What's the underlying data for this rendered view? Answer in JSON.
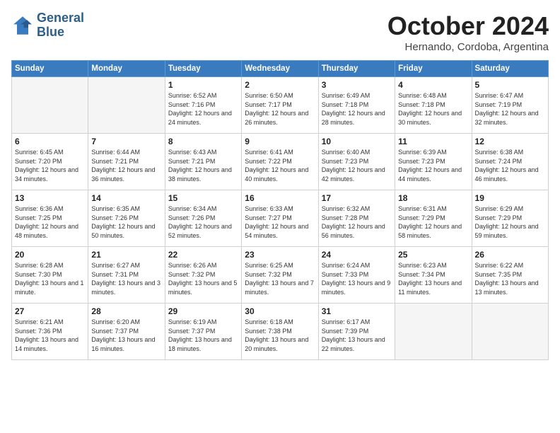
{
  "logo": {
    "line1": "General",
    "line2": "Blue"
  },
  "title": "October 2024",
  "location": "Hernando, Cordoba, Argentina",
  "days_of_week": [
    "Sunday",
    "Monday",
    "Tuesday",
    "Wednesday",
    "Thursday",
    "Friday",
    "Saturday"
  ],
  "weeks": [
    [
      {
        "day": "",
        "empty": true
      },
      {
        "day": "",
        "empty": true
      },
      {
        "day": "1",
        "sunrise": "6:52 AM",
        "sunset": "7:16 PM",
        "daylight": "12 hours and 24 minutes."
      },
      {
        "day": "2",
        "sunrise": "6:50 AM",
        "sunset": "7:17 PM",
        "daylight": "12 hours and 26 minutes."
      },
      {
        "day": "3",
        "sunrise": "6:49 AM",
        "sunset": "7:18 PM",
        "daylight": "12 hours and 28 minutes."
      },
      {
        "day": "4",
        "sunrise": "6:48 AM",
        "sunset": "7:18 PM",
        "daylight": "12 hours and 30 minutes."
      },
      {
        "day": "5",
        "sunrise": "6:47 AM",
        "sunset": "7:19 PM",
        "daylight": "12 hours and 32 minutes."
      }
    ],
    [
      {
        "day": "6",
        "sunrise": "6:45 AM",
        "sunset": "7:20 PM",
        "daylight": "12 hours and 34 minutes."
      },
      {
        "day": "7",
        "sunrise": "6:44 AM",
        "sunset": "7:21 PM",
        "daylight": "12 hours and 36 minutes."
      },
      {
        "day": "8",
        "sunrise": "6:43 AM",
        "sunset": "7:21 PM",
        "daylight": "12 hours and 38 minutes."
      },
      {
        "day": "9",
        "sunrise": "6:41 AM",
        "sunset": "7:22 PM",
        "daylight": "12 hours and 40 minutes."
      },
      {
        "day": "10",
        "sunrise": "6:40 AM",
        "sunset": "7:23 PM",
        "daylight": "12 hours and 42 minutes."
      },
      {
        "day": "11",
        "sunrise": "6:39 AM",
        "sunset": "7:23 PM",
        "daylight": "12 hours and 44 minutes."
      },
      {
        "day": "12",
        "sunrise": "6:38 AM",
        "sunset": "7:24 PM",
        "daylight": "12 hours and 46 minutes."
      }
    ],
    [
      {
        "day": "13",
        "sunrise": "6:36 AM",
        "sunset": "7:25 PM",
        "daylight": "12 hours and 48 minutes."
      },
      {
        "day": "14",
        "sunrise": "6:35 AM",
        "sunset": "7:26 PM",
        "daylight": "12 hours and 50 minutes."
      },
      {
        "day": "15",
        "sunrise": "6:34 AM",
        "sunset": "7:26 PM",
        "daylight": "12 hours and 52 minutes."
      },
      {
        "day": "16",
        "sunrise": "6:33 AM",
        "sunset": "7:27 PM",
        "daylight": "12 hours and 54 minutes."
      },
      {
        "day": "17",
        "sunrise": "6:32 AM",
        "sunset": "7:28 PM",
        "daylight": "12 hours and 56 minutes."
      },
      {
        "day": "18",
        "sunrise": "6:31 AM",
        "sunset": "7:29 PM",
        "daylight": "12 hours and 58 minutes."
      },
      {
        "day": "19",
        "sunrise": "6:29 AM",
        "sunset": "7:29 PM",
        "daylight": "12 hours and 59 minutes."
      }
    ],
    [
      {
        "day": "20",
        "sunrise": "6:28 AM",
        "sunset": "7:30 PM",
        "daylight": "13 hours and 1 minute."
      },
      {
        "day": "21",
        "sunrise": "6:27 AM",
        "sunset": "7:31 PM",
        "daylight": "13 hours and 3 minutes."
      },
      {
        "day": "22",
        "sunrise": "6:26 AM",
        "sunset": "7:32 PM",
        "daylight": "13 hours and 5 minutes."
      },
      {
        "day": "23",
        "sunrise": "6:25 AM",
        "sunset": "7:32 PM",
        "daylight": "13 hours and 7 minutes."
      },
      {
        "day": "24",
        "sunrise": "6:24 AM",
        "sunset": "7:33 PM",
        "daylight": "13 hours and 9 minutes."
      },
      {
        "day": "25",
        "sunrise": "6:23 AM",
        "sunset": "7:34 PM",
        "daylight": "13 hours and 11 minutes."
      },
      {
        "day": "26",
        "sunrise": "6:22 AM",
        "sunset": "7:35 PM",
        "daylight": "13 hours and 13 minutes."
      }
    ],
    [
      {
        "day": "27",
        "sunrise": "6:21 AM",
        "sunset": "7:36 PM",
        "daylight": "13 hours and 14 minutes."
      },
      {
        "day": "28",
        "sunrise": "6:20 AM",
        "sunset": "7:37 PM",
        "daylight": "13 hours and 16 minutes."
      },
      {
        "day": "29",
        "sunrise": "6:19 AM",
        "sunset": "7:37 PM",
        "daylight": "13 hours and 18 minutes."
      },
      {
        "day": "30",
        "sunrise": "6:18 AM",
        "sunset": "7:38 PM",
        "daylight": "13 hours and 20 minutes."
      },
      {
        "day": "31",
        "sunrise": "6:17 AM",
        "sunset": "7:39 PM",
        "daylight": "13 hours and 22 minutes."
      },
      {
        "day": "",
        "empty": true
      },
      {
        "day": "",
        "empty": true
      }
    ]
  ]
}
